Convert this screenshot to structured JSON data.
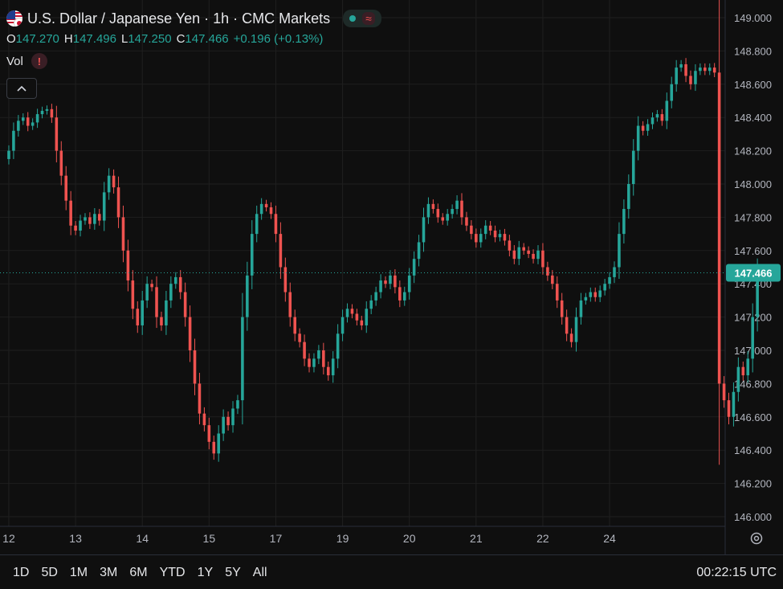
{
  "header": {
    "title": "U.S. Dollar / Japanese Yen · 1h · CMC Markets",
    "market_status_icon": "market-open-dot",
    "wave_icon": "≈"
  },
  "ohlc": {
    "o_label": "O",
    "o": "147.270",
    "h_label": "H",
    "h": "147.496",
    "l_label": "L",
    "l": "147.250",
    "c_label": "C",
    "c": "147.466",
    "change": "+0.196 (+0.13%)"
  },
  "volume": {
    "label": "Vol",
    "warning_icon": "!"
  },
  "collapse_icon": "chevron-up",
  "time_ranges": [
    "1D",
    "5D",
    "1M",
    "3M",
    "6M",
    "YTD",
    "1Y",
    "5Y",
    "All"
  ],
  "clock": "00:22:15 UTC",
  "colors": {
    "up": "#26a69a",
    "down": "#ef5350",
    "background": "#0f0f0f",
    "grid": "#1f1f1f"
  },
  "chart_data": {
    "type": "candlestick",
    "y_ticks": [
      "149.000",
      "148.800",
      "148.600",
      "148.400",
      "148.200",
      "148.000",
      "147.800",
      "147.600",
      "147.400",
      "147.200",
      "147.000",
      "146.800",
      "146.600",
      "146.400",
      "146.200",
      "146.000"
    ],
    "ylim": [
      146.0,
      149.0
    ],
    "x_ticks": [
      "12",
      "13",
      "14",
      "15",
      "17",
      "19",
      "20",
      "21",
      "22",
      "24"
    ],
    "last_price": "147.466",
    "last_price_value": 147.466,
    "grid": true,
    "series": [
      {
        "name": "USD/JPY 1h",
        "close": [
          148.2,
          148.32,
          148.38,
          148.4,
          148.35,
          148.37,
          148.42,
          148.44,
          148.45,
          148.4,
          148.2,
          148.05,
          147.9,
          147.75,
          147.72,
          147.78,
          147.8,
          147.76,
          147.82,
          147.78,
          147.95,
          148.05,
          147.98,
          147.8,
          147.6,
          147.42,
          147.25,
          147.15,
          147.3,
          147.4,
          147.38,
          147.2,
          147.15,
          147.3,
          147.4,
          147.44,
          147.35,
          147.2,
          147.0,
          146.8,
          146.62,
          146.55,
          146.45,
          146.38,
          146.5,
          146.6,
          146.55,
          146.65,
          146.7,
          147.2,
          147.45,
          147.7,
          147.82,
          147.88,
          147.86,
          147.82,
          147.7,
          147.5,
          147.35,
          147.2,
          147.1,
          147.05,
          146.95,
          146.9,
          146.95,
          147.0,
          146.9,
          146.85,
          146.95,
          147.1,
          147.2,
          147.25,
          147.22,
          147.18,
          147.15,
          147.25,
          147.3,
          147.35,
          147.42,
          147.4,
          147.45,
          147.38,
          147.3,
          147.35,
          147.45,
          147.55,
          147.65,
          147.8,
          147.88,
          147.85,
          147.8,
          147.78,
          147.82,
          147.85,
          147.9,
          147.8,
          147.75,
          147.7,
          147.65,
          147.7,
          147.75,
          147.72,
          147.68,
          147.7,
          147.66,
          147.6,
          147.55,
          147.62,
          147.6,
          147.58,
          147.55,
          147.6,
          147.5,
          147.45,
          147.4,
          147.3,
          147.2,
          147.1,
          147.05,
          147.2,
          147.3,
          147.32,
          147.35,
          147.32,
          147.36,
          147.4,
          147.44,
          147.5,
          147.7,
          147.85,
          148.0,
          148.2,
          148.35,
          148.32,
          148.36,
          148.4,
          148.42,
          148.38,
          148.5,
          148.6,
          148.7,
          148.72,
          148.65,
          148.6,
          148.68,
          148.7,
          148.68,
          148.7,
          148.67,
          146.8,
          146.7,
          146.6,
          146.75,
          146.9,
          146.85,
          146.95,
          147.2,
          147.466
        ]
      }
    ],
    "x_tick_index": [
      0,
      14,
      28,
      42,
      56,
      70,
      84,
      98,
      112,
      126
    ],
    "x_range_index": [
      -0.5,
      143
    ]
  }
}
